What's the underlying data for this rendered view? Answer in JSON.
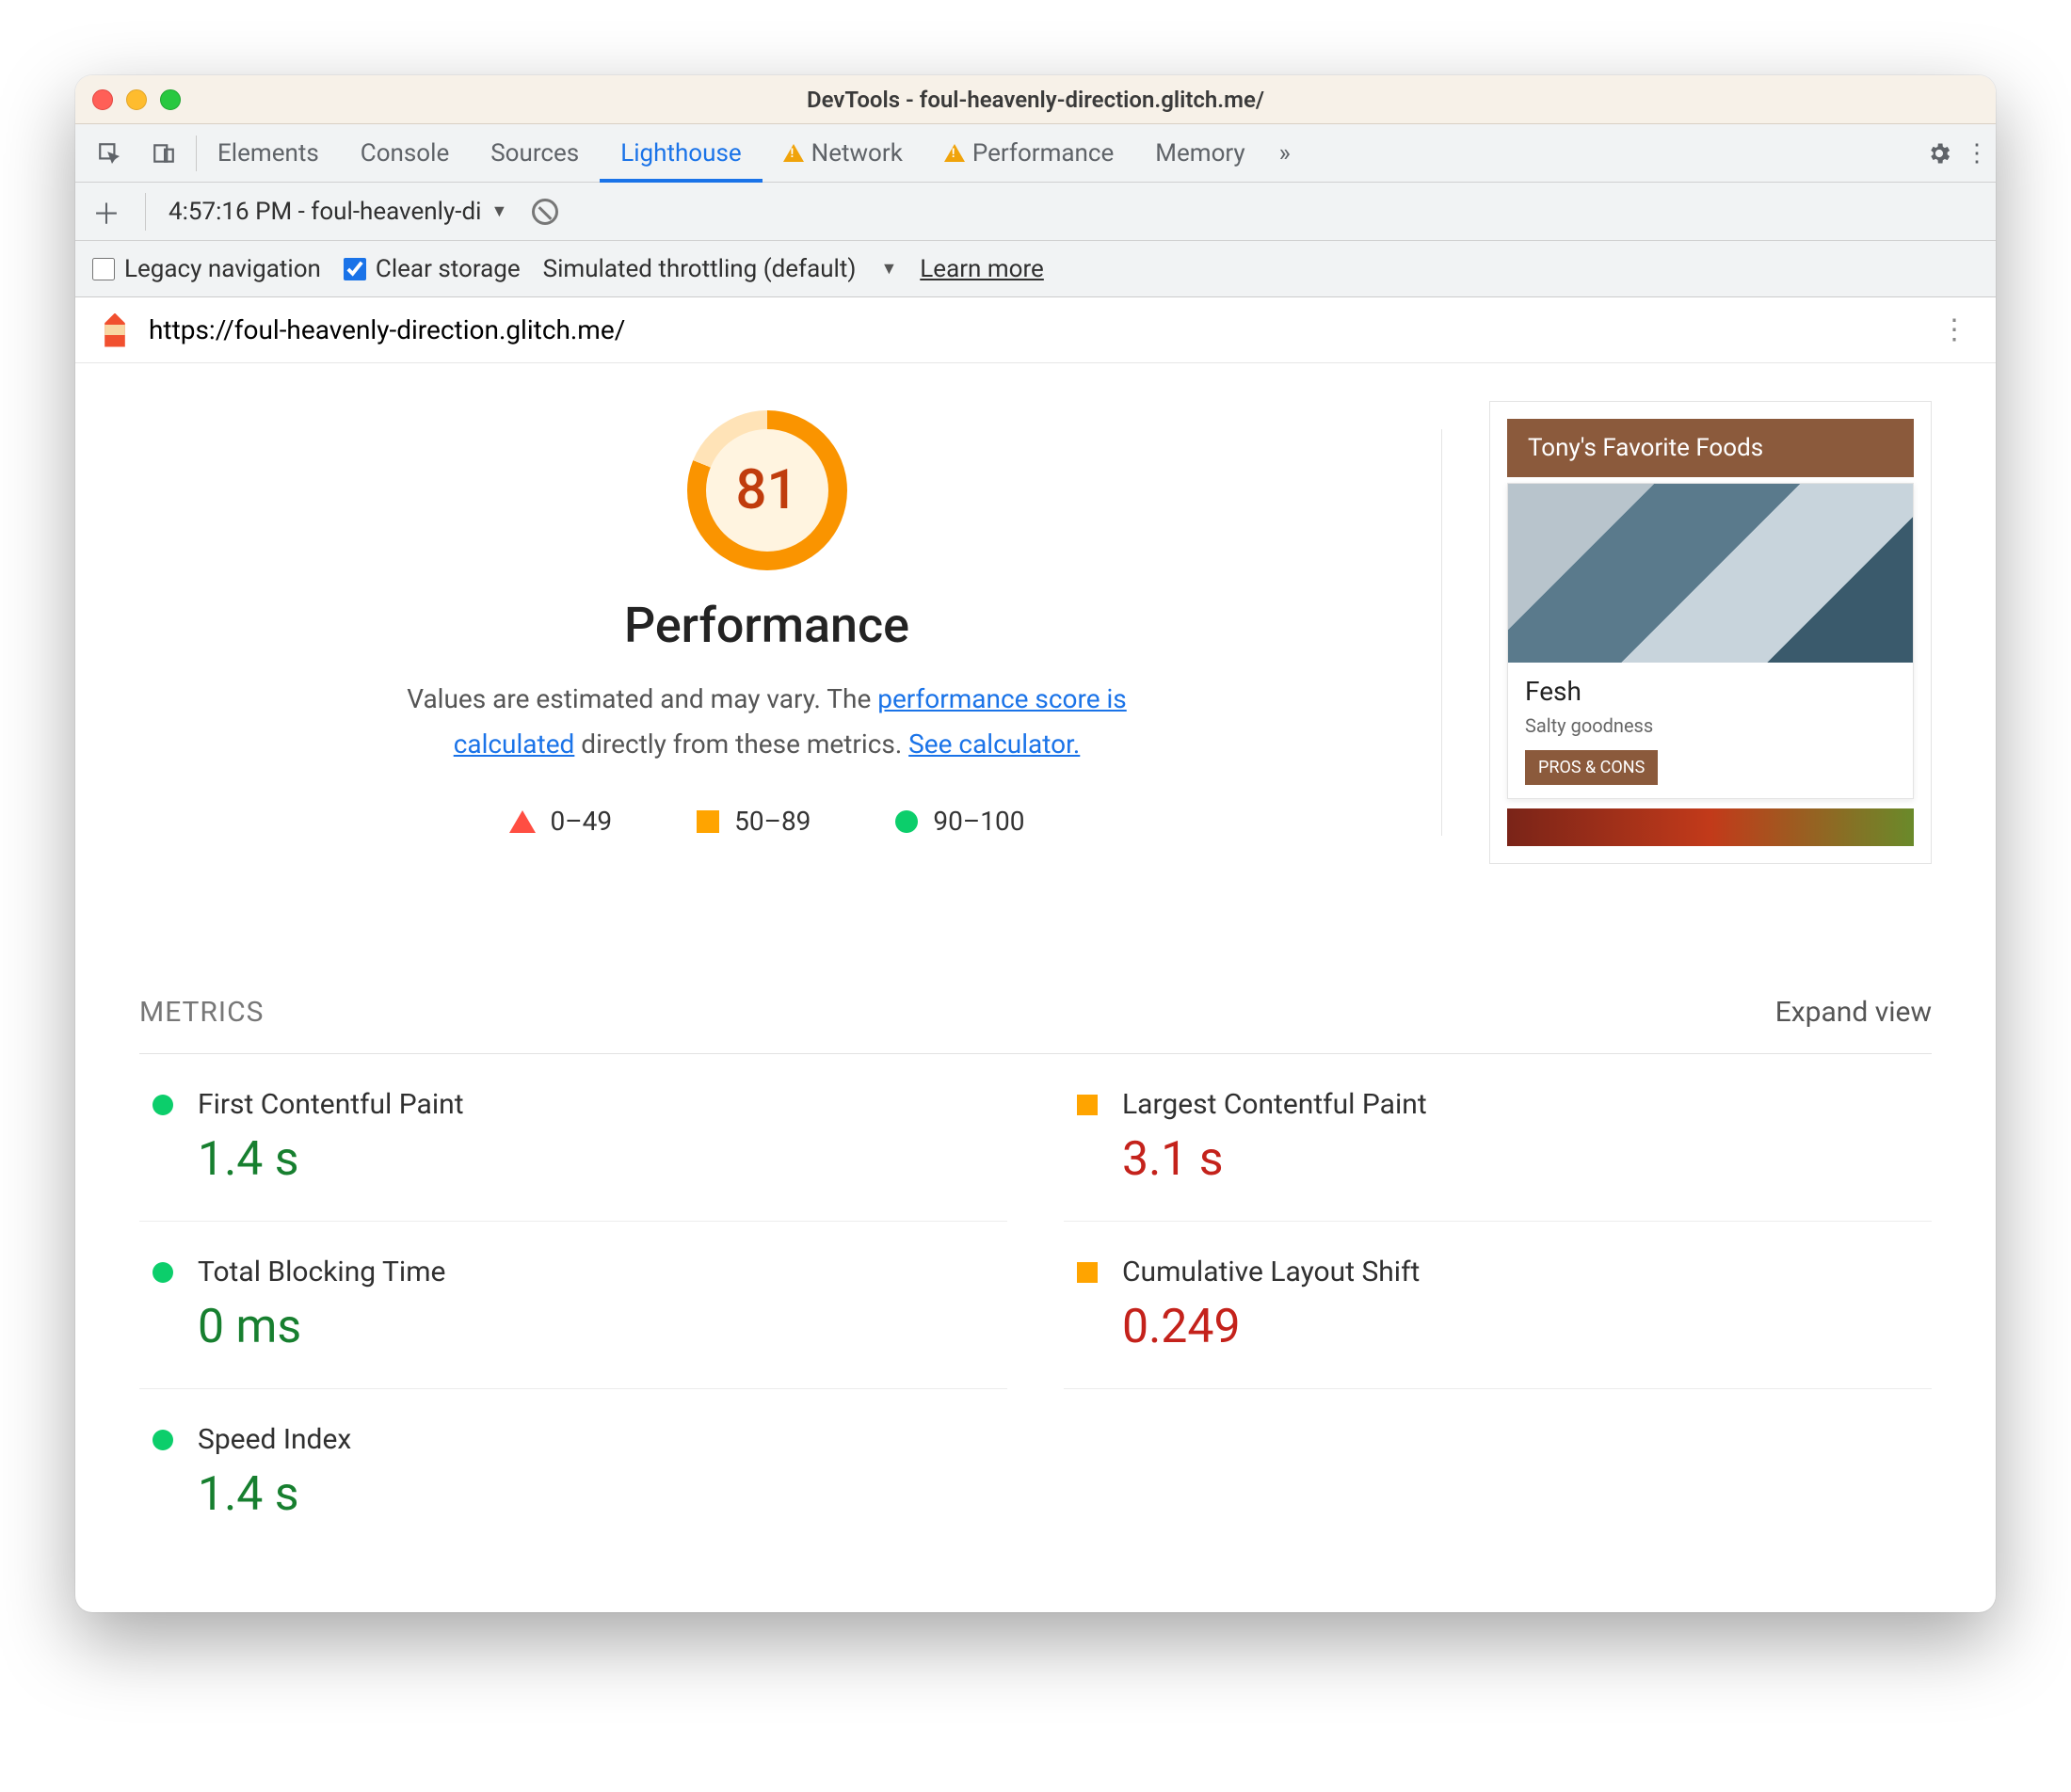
{
  "window": {
    "title": "DevTools - foul-heavenly-direction.glitch.me/"
  },
  "tabs": {
    "items": [
      "Elements",
      "Console",
      "Sources",
      "Lighthouse",
      "Network",
      "Performance",
      "Memory"
    ],
    "active": "Lighthouse",
    "warnings": [
      "Network",
      "Performance"
    ]
  },
  "subbar": {
    "report_label": "4:57:16 PM - foul-heavenly-di"
  },
  "options": {
    "legacy_label": "Legacy navigation",
    "legacy_checked": false,
    "clear_label": "Clear storage",
    "clear_checked": true,
    "throttling_label": "Simulated throttling (default)",
    "learn_more": "Learn more"
  },
  "urlbar": {
    "url": "https://foul-heavenly-direction.glitch.me/"
  },
  "gauge": {
    "score": "81",
    "category": "Performance",
    "desc_prefix": "Values are estimated and may vary. The ",
    "desc_link1": "performance score is calculated",
    "desc_mid": " directly from these metrics. ",
    "desc_link2": "See calculator."
  },
  "legend": {
    "fail": "0–49",
    "avg": "50–89",
    "pass": "90–100"
  },
  "preview": {
    "header": "Tony's Favorite Foods",
    "card_title": "Fesh",
    "card_sub": "Salty goodness",
    "card_btn": "PROS & CONS"
  },
  "metrics": {
    "heading": "METRICS",
    "expand": "Expand view",
    "items": [
      {
        "name": "First Contentful Paint",
        "value": "1.4 s",
        "status": "pass"
      },
      {
        "name": "Largest Contentful Paint",
        "value": "3.1 s",
        "status": "average"
      },
      {
        "name": "Total Blocking Time",
        "value": "0 ms",
        "status": "pass"
      },
      {
        "name": "Cumulative Layout Shift",
        "value": "0.249",
        "status": "average"
      },
      {
        "name": "Speed Index",
        "value": "1.4 s",
        "status": "pass"
      }
    ]
  }
}
